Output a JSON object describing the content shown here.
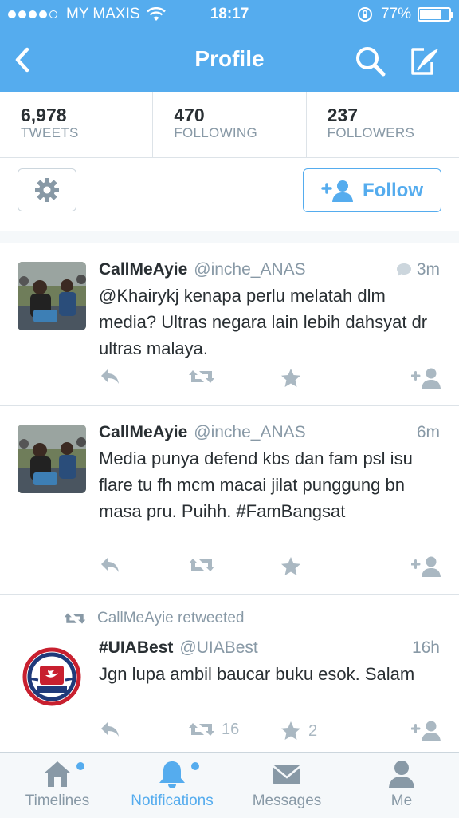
{
  "status_bar": {
    "carrier": "MY MAXIS",
    "time": "18:17",
    "battery": "77%",
    "battery_level": 0.77
  },
  "nav": {
    "title": "Profile"
  },
  "stats": [
    {
      "value": "6,978",
      "label": "TWEETS"
    },
    {
      "value": "470",
      "label": "FOLLOWING"
    },
    {
      "value": "237",
      "label": "FOLLOWERS"
    }
  ],
  "follow_label": "Follow",
  "tweets": [
    {
      "name": "CallMeAyie",
      "handle": "@inche_ANAS",
      "time": "3m",
      "text": "@Khairykj kenapa perlu melatah dlm media? Ultras negara lain lebih dahsyat dr ultras malaya."
    },
    {
      "name": "CallMeAyie",
      "handle": "@inche_ANAS",
      "time": "6m",
      "text": "Media punya defend kbs dan fam psl isu flare tu fh mcm macai jilat punggung bn masa pru. Puihh. #FamBangsat"
    },
    {
      "retweeted_by": "CallMeAyie retweeted",
      "name": "#UIABest",
      "handle": "@UIABest",
      "time": "16h",
      "text": "Jgn lupa ambil baucar buku esok. Salam",
      "retweets": "16",
      "favorites": "2"
    }
  ],
  "tabs": [
    {
      "label": "Timelines"
    },
    {
      "label": "Notifications"
    },
    {
      "label": "Messages"
    },
    {
      "label": "Me"
    }
  ],
  "colors": {
    "accent": "#55acee",
    "text": "#292f33",
    "muted": "#8899a6",
    "icon": "#aab8c2"
  }
}
